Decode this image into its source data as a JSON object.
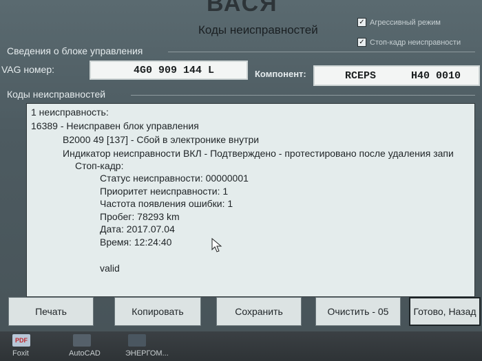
{
  "app": {
    "title": "ВАСЯ",
    "subtitle": "Коды неисправностей"
  },
  "options": {
    "aggressive_mode": {
      "label": "Агрессивный режим",
      "checked": true
    },
    "freeze_frame": {
      "label": "Стоп-кадр неисправности",
      "checked": true
    }
  },
  "control_unit": {
    "group_label": "Сведения о блоке управления",
    "part_number_label": "VAG номер:",
    "part_number": "4G0 909 144 L",
    "component_label": "Компонент:",
    "component_name": "RCEPS",
    "component_version": "H40 0010"
  },
  "faults": {
    "group_label": "Коды неисправностей",
    "lines": [
      "1 неисправность:",
      "16389 - Неисправен блок управления",
      "B2000 49 [137] - Сбой в электронике внутри",
      "Индикатор неисправности ВКЛ - Подтверждено - протестировано после удаления запи",
      "Стоп-кадр:",
      "Статус неисправности: 00000001",
      "Приоритет неисправности: 1",
      "Частота появления ошибки: 1",
      "Пробег: 78293 km",
      "Дата: 2017.07.04",
      "Время: 12:24:40",
      "valid"
    ]
  },
  "buttons": {
    "print": "Печать",
    "copy": "Копировать",
    "save": "Сохранить",
    "clear": "Очистить - 05",
    "done": "Готово, Назад"
  },
  "taskbar": {
    "items": [
      "Foxit",
      "AutoCAD",
      "ЭНЕРГОМ..."
    ],
    "pdf_badge": "PDF"
  }
}
